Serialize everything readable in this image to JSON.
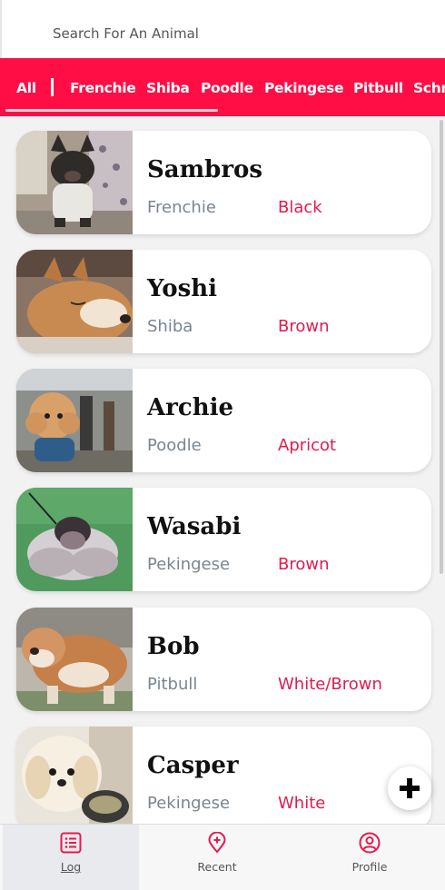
{
  "search": {
    "placeholder": "Search For An Animal"
  },
  "tabs": [
    "All",
    "Frenchie",
    "Shiba",
    "Poodle",
    "Pekingese",
    "Pitbull",
    "Schnauzer"
  ],
  "colors": {
    "brand": "#ff0d45",
    "accent_text": "#e31b4b",
    "secondary_text": "#7a8590"
  },
  "animals": [
    {
      "name": "Sambros",
      "breed": "Frenchie",
      "color": "Black",
      "photo_icon": "frenchie-photo"
    },
    {
      "name": "Yoshi",
      "breed": "Shiba",
      "color": "Brown",
      "photo_icon": "shiba-photo"
    },
    {
      "name": "Archie",
      "breed": "Poodle",
      "color": "Apricot",
      "photo_icon": "poodle-photo"
    },
    {
      "name": "Wasabi",
      "breed": "Pekingese",
      "color": "Brown",
      "photo_icon": "pekingese-photo"
    },
    {
      "name": "Bob",
      "breed": "Pitbull",
      "color": "White/Brown",
      "photo_icon": "pitbull-photo"
    },
    {
      "name": "Casper",
      "breed": "Pekingese",
      "color": "White",
      "photo_icon": "pekingese-photo"
    }
  ],
  "fab": {
    "icon": "plus-icon"
  },
  "nav": [
    {
      "label": "Log",
      "icon": "list-icon"
    },
    {
      "label": "Recent",
      "icon": "location-pin-icon"
    },
    {
      "label": "Profile",
      "icon": "user-circle-icon"
    }
  ]
}
